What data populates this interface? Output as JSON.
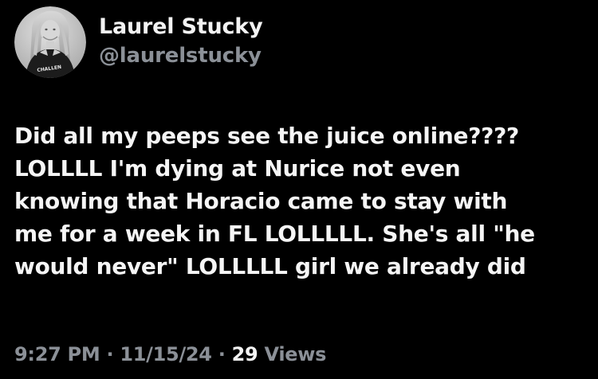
{
  "author": {
    "display_name": "Laurel Stucky",
    "handle": "@laurelstucky",
    "avatar_icon": "profile-photo-avatar",
    "avatar_shirt_text": "CHALLEN"
  },
  "tweet": {
    "lines": [
      "Did all my peeps see the juice online????",
      "LOLLLL I'm dying at Nurice not even",
      "knowing that Horacio came to stay with",
      "me for a week in FL LOLLLLL. She's all \"he",
      "would never\" LOLLLLL girl we already did"
    ]
  },
  "meta": {
    "time": "9:27 PM",
    "separator": " · ",
    "date": "11/15/24",
    "views_count": "29",
    "views_label": " Views"
  },
  "colors": {
    "background": "#000000",
    "primary_text": "#f3f3f3",
    "secondary_text": "#8b9097"
  }
}
